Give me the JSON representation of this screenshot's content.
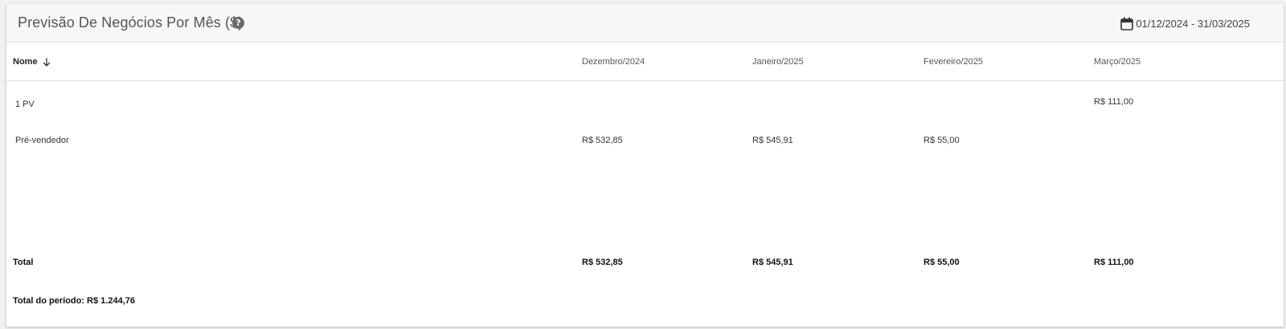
{
  "header": {
    "title": "Previsão De Negócios Por Mês ($)",
    "date_range": "01/12/2024 - 31/03/2025"
  },
  "table": {
    "name_header": "Nome",
    "columns": [
      "Dezembro/2024",
      "Janeiro/2025",
      "Fevereiro/2025",
      "Março/2025"
    ],
    "rows": [
      {
        "name": "1 PV",
        "values": [
          "",
          "",
          "",
          "R$ 111,00"
        ]
      },
      {
        "name": "Pré-vendedor",
        "values": [
          "R$ 532,85",
          "R$ 545,91",
          "R$ 55,00",
          ""
        ]
      }
    ],
    "total": {
      "label": "Total",
      "values": [
        "R$ 532,85",
        "R$ 545,91",
        "R$ 55,00",
        "R$ 111,00"
      ]
    },
    "period_total": "Total do período: R$ 1.244,76"
  },
  "icons": {
    "help": "help-circle-icon",
    "calendar": "calendar-icon",
    "sort": "arrow-down-icon"
  }
}
